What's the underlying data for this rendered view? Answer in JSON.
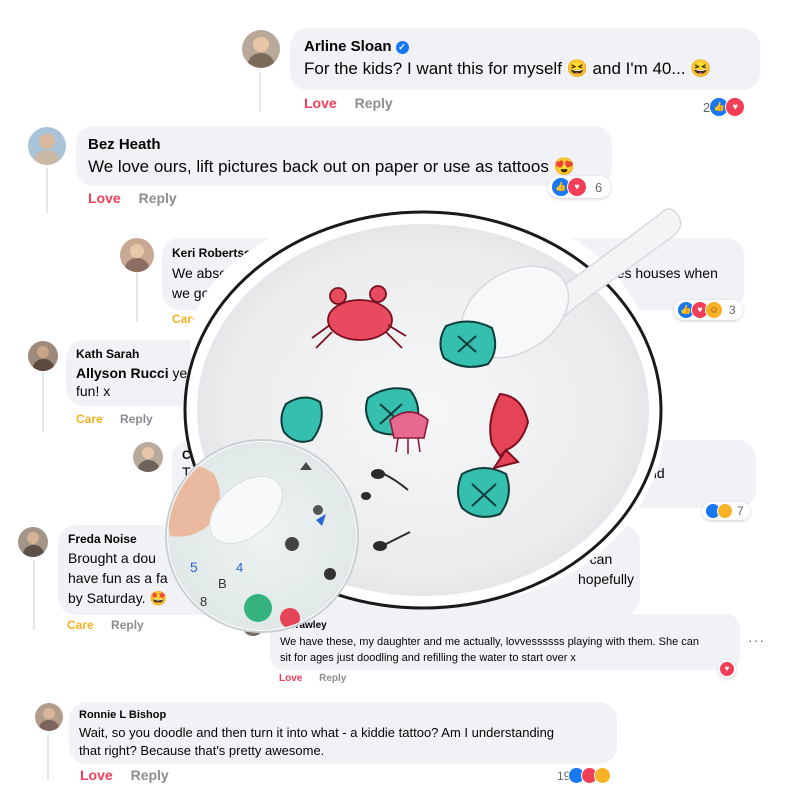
{
  "colors": {
    "love": "#f33e58",
    "care": "#f7b125",
    "like": "#1877f2",
    "muted": "#8a8d91",
    "bubble": "#f0f2f5"
  },
  "comments": [
    {
      "author": "Arline Sloan",
      "verified": true,
      "text": "For the kids? I want this for myself 😆 and I'm 40... 😆",
      "actions": [
        "Love",
        "Reply"
      ],
      "reaction_count": "2",
      "reaction_icons": [
        "like-icon",
        "heart-icon"
      ]
    },
    {
      "author": "Bez Heath",
      "text": "We love ours, lift pictures back out on paper or use as tattoos 😍",
      "actions": [
        "Love",
        "Reply"
      ],
      "reaction_count": "6",
      "reaction_icons": [
        "like-icon",
        "heart-icon"
      ]
    },
    {
      "author": "Keri Robertson",
      "text": "We absolut\nwe go fo",
      "text_right": "oples houses when\nce!",
      "actions": [
        "Care"
      ],
      "reaction_count": "3",
      "reaction_icons": [
        "like-icon",
        "heart-icon",
        "haha-icon"
      ]
    },
    {
      "author": "Kath Sarah",
      "mention": "Allyson Rucci",
      "text": "ye",
      "text2": "fun! x",
      "actions": [
        "Care",
        "Reply"
      ]
    },
    {
      "author": "Ca",
      "text": "T",
      "text_right": "uld",
      "reaction_count": "7"
    },
    {
      "author": "Freda Noise",
      "text": "Brought a dou\nhave fun as a fa\nby Saturday. 🤩",
      "text_right": "e can\nhopefully",
      "actions": [
        "Care",
        "Reply"
      ]
    },
    {
      "author": "e Crawley",
      "text": "We have these, my daughter and me actually, lovvessssss playing with them. She can\nsit for ages just doodling and refilling the water to start over x",
      "actions": [
        "Love",
        "Reply"
      ]
    },
    {
      "author": "Ronnie L Bishop",
      "text": "Wait, so you doodle and then turn it into what - a kiddie tattoo? Am I understanding\nthat right? Because that's pretty awesome.",
      "actions": [
        "Love",
        "Reply"
      ],
      "reaction_count": "19",
      "reaction_icons": [
        "like-icon",
        "heart-icon",
        "haha-icon"
      ]
    }
  ],
  "product_overlay": {
    "inset_glyphs": [
      "5",
      "B",
      "4",
      "8"
    ]
  }
}
